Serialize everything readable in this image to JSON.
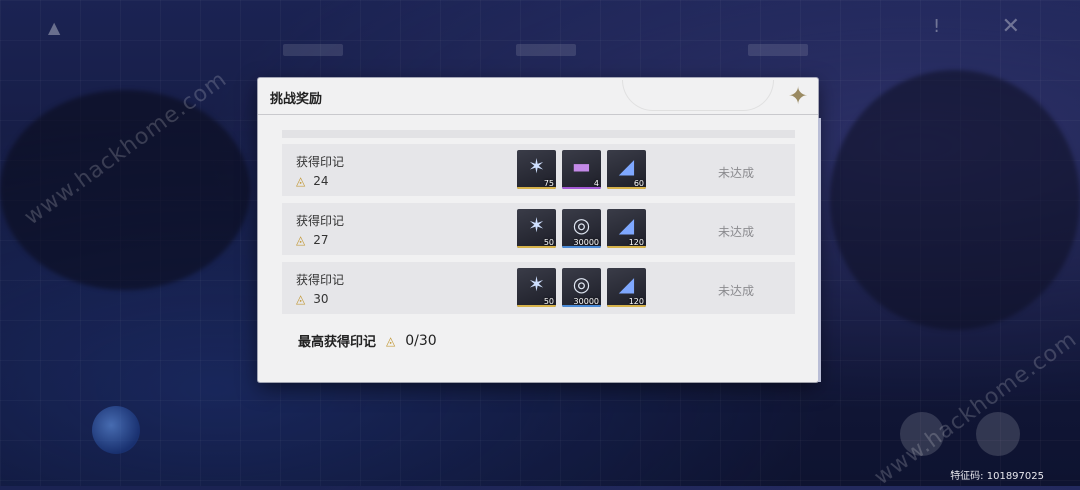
{
  "background": {
    "watermark_text": "www.hackhome.com",
    "feature_code": "特征码: 101897025"
  },
  "dialog": {
    "title": "挑战奖励",
    "rows": [
      {
        "label": "获得印记",
        "marks": "24",
        "status": "未达成",
        "items": [
          {
            "icon": "star-crystal-icon",
            "count": "75",
            "rarity_color": "#d6b24a"
          },
          {
            "icon": "purple-cylinder-icon",
            "count": "4",
            "rarity_color": "#a45ad6"
          },
          {
            "icon": "blue-pyramid-icon",
            "count": "60",
            "rarity_color": "#d6b24a"
          }
        ]
      },
      {
        "label": "获得印记",
        "marks": "27",
        "status": "未达成",
        "items": [
          {
            "icon": "star-crystal-icon",
            "count": "50",
            "rarity_color": "#d6b24a"
          },
          {
            "icon": "silver-coin-icon",
            "count": "30000",
            "rarity_color": "#4a8ad6"
          },
          {
            "icon": "blue-pyramid-icon",
            "count": "120",
            "rarity_color": "#d6b24a"
          }
        ]
      },
      {
        "label": "获得印记",
        "marks": "30",
        "status": "未达成",
        "items": [
          {
            "icon": "star-crystal-icon",
            "count": "50",
            "rarity_color": "#d6b24a"
          },
          {
            "icon": "silver-coin-icon",
            "count": "30000",
            "rarity_color": "#4a8ad6"
          },
          {
            "icon": "blue-pyramid-icon",
            "count": "120",
            "rarity_color": "#d6b24a"
          }
        ]
      }
    ],
    "summary": {
      "label": "最高获得印记",
      "value": "0/30"
    }
  },
  "colors": {
    "mark_gold": "#c39a3a",
    "status_gray": "#8b8b8f"
  }
}
